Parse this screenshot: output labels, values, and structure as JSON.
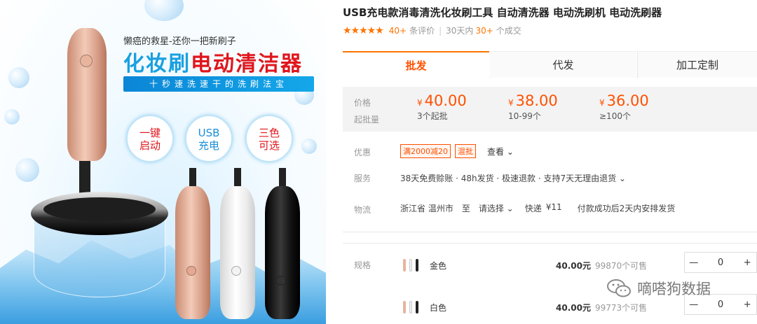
{
  "product_image": {
    "slogan": "懒癌的救星-还你一把新刷子",
    "title_part1": "化妆刷",
    "title_part2": "电动清洁器",
    "banner": "十秒速洗速干的洗刷法宝",
    "features": [
      {
        "line1": "一键",
        "line2": "启动"
      },
      {
        "line1": "USB",
        "line2": "充电"
      },
      {
        "line1": "三色",
        "line2": "可选"
      }
    ]
  },
  "product": {
    "title": "USB充电款消毒清洗化妆刷工具 自动清洗器 电动洗刷机 电动洗刷器",
    "stars": "★★★★★",
    "review_count": "40+",
    "review_label": "条评价",
    "sales_prefix": "30天内",
    "sales_count": "30+",
    "sales_label": "个成交"
  },
  "tabs": [
    "批发",
    "代发",
    "加工定制"
  ],
  "pricing": {
    "price_label": "价格",
    "min_label": "起批量",
    "currency": "¥",
    "tiers": [
      {
        "price": "40.00",
        "qty": "3个起批"
      },
      {
        "price": "38.00",
        "qty": "10-99个"
      },
      {
        "price": "36.00",
        "qty": "≥100个"
      }
    ]
  },
  "promo": {
    "label": "优惠",
    "tags": [
      "满2000减20",
      "混批"
    ],
    "see_more": "查看 ⌄"
  },
  "service": {
    "label": "服务",
    "text": "38天免费赊账 · 48h发货 · 极速退款 · 支持7天无理由退货 ⌄"
  },
  "shipping": {
    "label": "物流",
    "from": "浙江省 温州市",
    "to_word": "至",
    "select": "请选择 ⌄",
    "method": "快递",
    "fee": "¥11",
    "note": "付款成功后2天内安排发货"
  },
  "sku": {
    "label": "规格",
    "items": [
      {
        "name": "金色",
        "price": "40.00元",
        "stock": "99870个可售",
        "qty": "0",
        "minus": "—",
        "plus": "+"
      },
      {
        "name": "白色",
        "price": "40.00元",
        "stock": "99773个可售",
        "qty": "0",
        "minus": "—",
        "plus": "+"
      }
    ]
  },
  "watermark": "嘀嗒狗数据",
  "colors": {
    "accent": "#ff5000",
    "orange": "#ff7300",
    "brand_blue": "#1aa0e0",
    "brand_red": "#e0161c"
  }
}
